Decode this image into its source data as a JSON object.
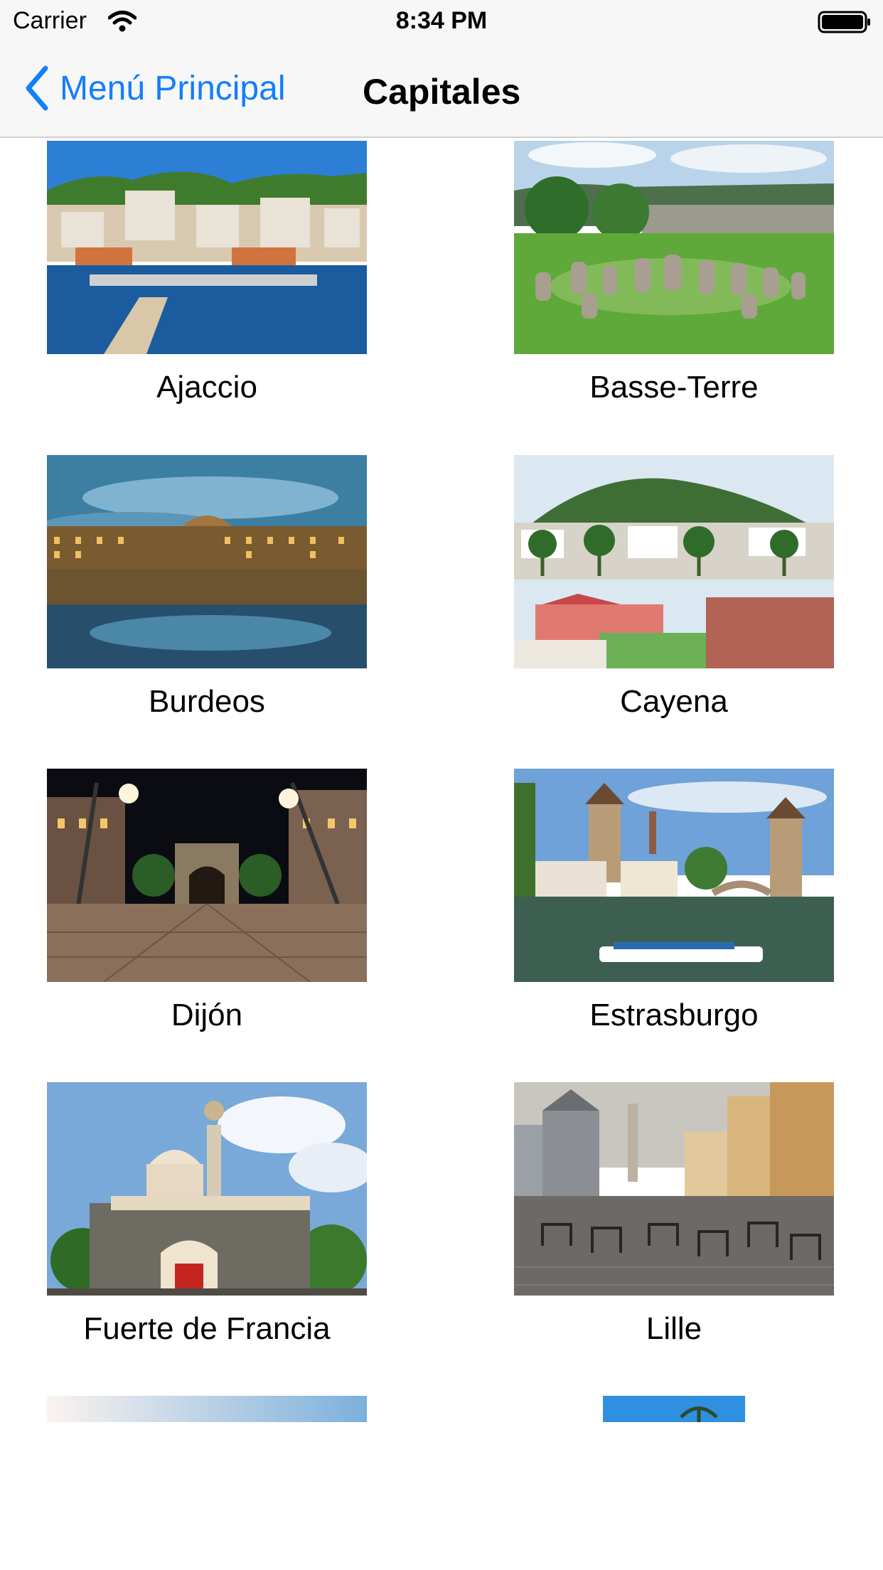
{
  "status_bar": {
    "carrier": "Carrier",
    "time": "8:34 PM",
    "icons": [
      "wifi-icon",
      "battery-icon"
    ]
  },
  "nav": {
    "back_label": "Menú Principal",
    "title": "Capitales",
    "accent_color": "#147efb",
    "back_icon": "chevron-left-icon"
  },
  "cities": [
    {
      "name": "Ajaccio"
    },
    {
      "name": "Basse-Terre"
    },
    {
      "name": "Burdeos"
    },
    {
      "name": "Cayena"
    },
    {
      "name": "Dijón"
    },
    {
      "name": "Estrasburgo"
    },
    {
      "name": "Fuerte de Francia"
    },
    {
      "name": "Lille"
    }
  ]
}
